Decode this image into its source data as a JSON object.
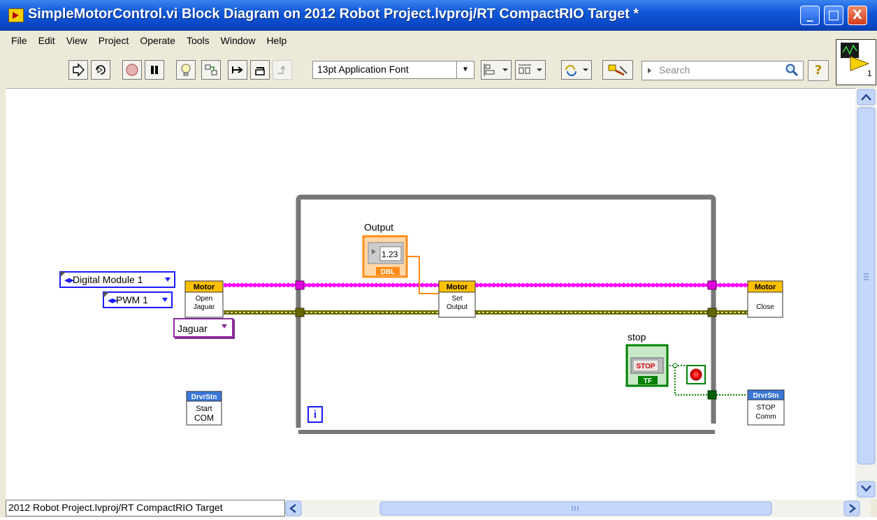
{
  "window": {
    "title": "SimpleMotorControl.vi Block Diagram on 2012 Robot Project.lvproj/RT CompactRIO Target *",
    "min_glyph": "_",
    "max_glyph": "□",
    "close_glyph": "X"
  },
  "menu": {
    "items": [
      "File",
      "Edit",
      "View",
      "Project",
      "Operate",
      "Tools",
      "Window",
      "Help"
    ]
  },
  "toolbar": {
    "font_value": "13pt Application Font",
    "search_placeholder": "Search",
    "help_glyph": "?",
    "vi_icon_number": "1"
  },
  "diagram": {
    "digital_module": "Digital Module 1",
    "pwm": "PWM 1",
    "jaguar": "Jaguar",
    "output_label": "Output",
    "output_numeric": "1.23",
    "output_type": "DBL",
    "stop_label": "stop",
    "stop_button": "STOP",
    "stop_type": "TF",
    "loop_iteration": "i",
    "open_header": "Motor",
    "open_line1": "Open",
    "open_line2": "Jaguar",
    "set_header": "Motor",
    "set_line1": "Set",
    "set_line2": "Output",
    "close_header": "Motor",
    "close_line1": "Close",
    "start_header": "DrvrStn",
    "start_line1": "Start",
    "start_line2": "COM",
    "stopcomm_header": "DrvrStn",
    "stopcomm_line1": "STOP",
    "stopcomm_line2": "Comm"
  },
  "status": {
    "path": "2012 Robot Project.lvproj/RT CompactRIO Target"
  },
  "colors": {
    "title_bar": "#0a46c4",
    "motor_wire": "#ff00ff",
    "refnum_wire": "#666600",
    "numeric_orange": "#ff8c1a",
    "boolean_green": "#008000",
    "loop_gray": "#777777",
    "enum_blue": "#1a1aff",
    "enum_purple": "#8a2a9a"
  }
}
